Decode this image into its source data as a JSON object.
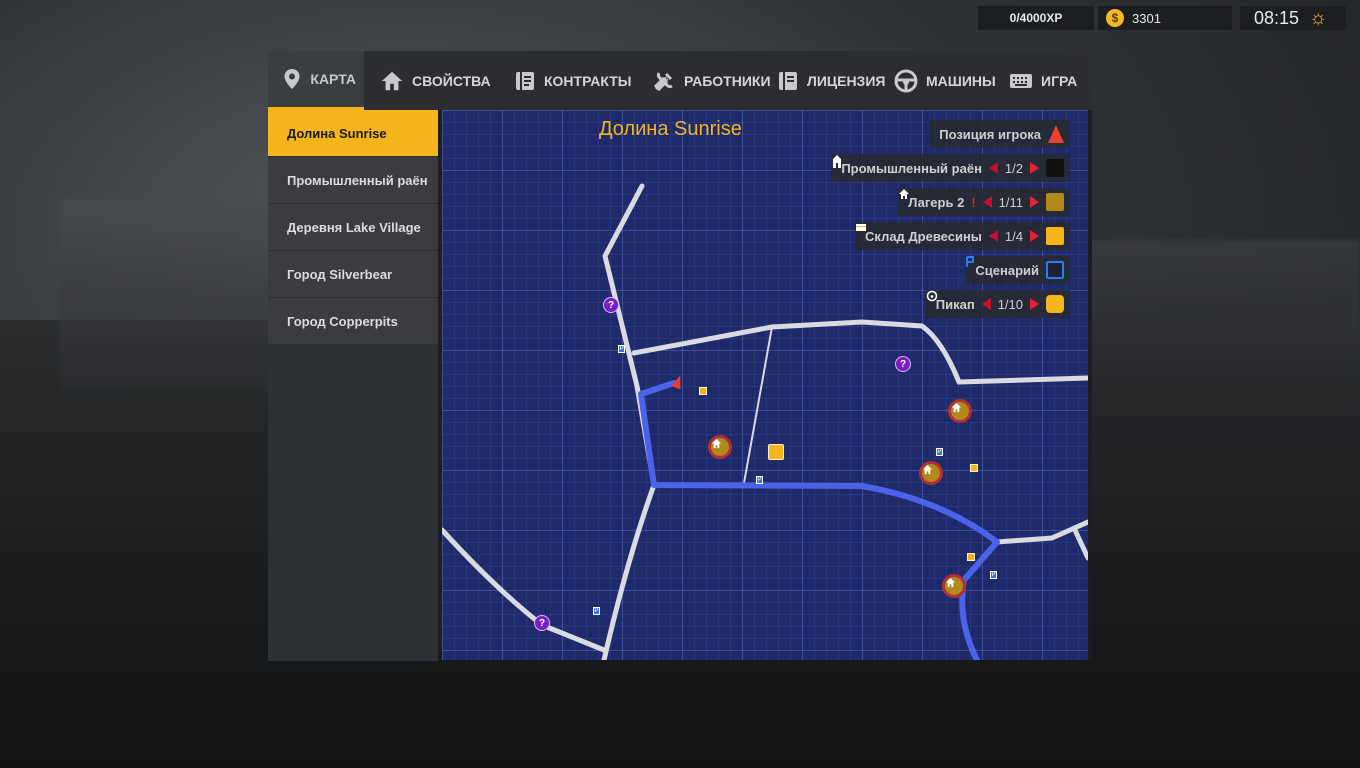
{
  "hud": {
    "xp": "0/4000XP",
    "money": "3301",
    "coin_symbol": "$",
    "time": "08:15",
    "weather_icon": "sun-icon"
  },
  "tabs": [
    {
      "label": "КАРТА",
      "icon": "map-pin-icon",
      "active": true
    },
    {
      "label": "СВОЙСТВА",
      "icon": "house-icon",
      "active": false
    },
    {
      "label": "КОНТРАКТЫ",
      "icon": "contract-icon",
      "active": false
    },
    {
      "label": "РАБОТНИКИ",
      "icon": "tools-icon",
      "active": false
    },
    {
      "label": "ЛИЦЕНЗИЯ",
      "icon": "license-icon",
      "active": false
    },
    {
      "label": "МАШИНЫ",
      "icon": "steering-wheel-icon",
      "active": false
    },
    {
      "label": "ИГРА",
      "icon": "keyboard-icon",
      "active": false
    }
  ],
  "sidebar": {
    "items": [
      {
        "label": "Долина Sunrise",
        "active": true
      },
      {
        "label": "Промышленный раён",
        "active": false
      },
      {
        "label": "Деревня Lake Village",
        "active": false
      },
      {
        "label": "Город Silverbear",
        "active": false
      },
      {
        "label": "Город Copperpits",
        "active": false
      }
    ]
  },
  "map": {
    "title": "Долина Sunrise",
    "legend": {
      "player": {
        "label": "Позиция игрока"
      },
      "industrial": {
        "label": "Промышленный раён",
        "count": "1/2"
      },
      "camp": {
        "label": "Лагерь 2",
        "alert": "!",
        "count": "1/11"
      },
      "storage": {
        "label": "Склад Древесины",
        "count": "1/4"
      },
      "scenario": {
        "label": "Сценарий"
      },
      "pickup": {
        "label": "Пикап",
        "count": "1/10"
      }
    },
    "marker_symbols": {
      "unknown": "?",
      "parking": "P"
    }
  },
  "colors": {
    "accent": "#f4b51c",
    "map_bg": "#1f2a6b",
    "road": "#d9dbe0",
    "route": "#4a63e8",
    "arrow_red": "#e5232f"
  }
}
